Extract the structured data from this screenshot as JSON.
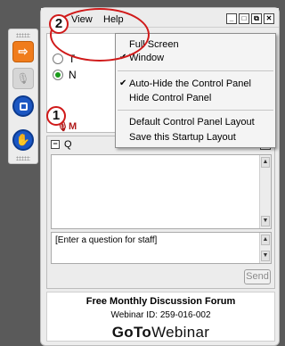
{
  "menubar": {
    "view": "View",
    "help": "Help"
  },
  "window_buttons": [
    "minimize",
    "restore",
    "popout",
    "close"
  ],
  "audio": {
    "letters": [
      "T",
      "N"
    ],
    "mic_letter": "M"
  },
  "questions": {
    "title": "Q",
    "input_placeholder": "[Enter a question for staff]",
    "send_label": "Send"
  },
  "footer": {
    "title": "Free Monthly Discussion Forum",
    "webinar_id": "Webinar ID: 259-016-002",
    "logo_bold": "GoTo",
    "logo_rest": "Webinar"
  },
  "menu": {
    "items": [
      {
        "label": "Full Screen",
        "checked": false
      },
      {
        "label": "Window",
        "checked": true
      },
      {
        "label": "Auto-Hide the Control Panel",
        "checked": true
      },
      {
        "label": "Hide Control Panel",
        "checked": false
      },
      {
        "label": "Default Control Panel Layout",
        "checked": false
      },
      {
        "label": "Save this Startup Layout",
        "checked": false
      }
    ]
  },
  "callouts": {
    "one": "1",
    "two": "2"
  },
  "colors": {
    "accent_orange": "#f07c1c",
    "callout_red": "#d01a1a",
    "screen_blue": "#1c57c2"
  }
}
